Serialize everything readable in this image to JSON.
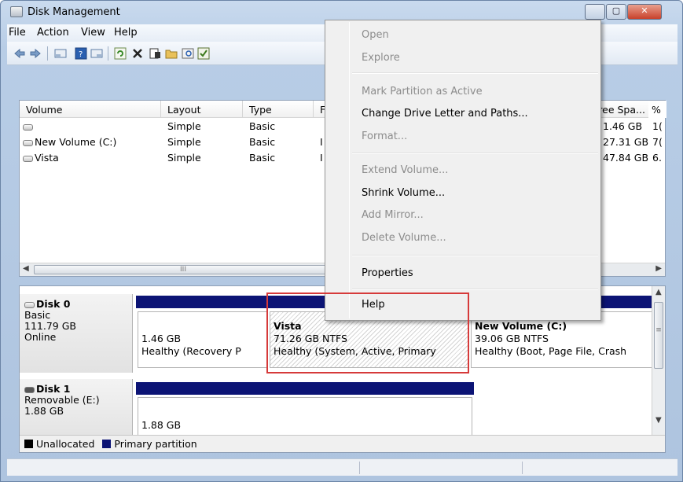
{
  "window": {
    "title": "Disk Management",
    "controls": {
      "minimize": "",
      "maximize": "▢",
      "close": "✕"
    }
  },
  "menubar": [
    "File",
    "Action",
    "View",
    "Help"
  ],
  "toolbar_icons": [
    "back-icon",
    "forward-icon",
    "console-tree-icon",
    "help-icon",
    "properties-list-icon",
    "refresh-icon",
    "delete-icon",
    "properties-icon",
    "open-icon",
    "search-icon",
    "disk-settings-icon"
  ],
  "volume_list": {
    "columns": [
      "Volume",
      "Layout",
      "Type",
      "F",
      "Free Spa...",
      "%"
    ],
    "rows": [
      {
        "volume": "",
        "layout": "Simple",
        "type": "Basic",
        "fs": "",
        "free": "1.46 GB",
        "pct": "1("
      },
      {
        "volume": "New Volume (C:)",
        "layout": "Simple",
        "type": "Basic",
        "fs": "I",
        "free": "27.31 GB",
        "pct": "7("
      },
      {
        "volume": "Vista",
        "layout": "Simple",
        "type": "Basic",
        "fs": "I",
        "free": "47.84 GB",
        "pct": "6."
      }
    ],
    "scroll_thumb_grip": "III"
  },
  "disks": [
    {
      "name": "Disk 0",
      "kind": "Basic",
      "size": "111.79 GB",
      "status": "Online",
      "partitions": [
        {
          "title": "",
          "size": "1.46 GB",
          "status": "Healthy (Recovery P"
        },
        {
          "title": "Vista",
          "size": "71.26 GB NTFS",
          "status": "Healthy (System, Active, Primary"
        },
        {
          "title": "New Volume (C:)",
          "size": "39.06 GB NTFS",
          "status": "Healthy (Boot, Page File, Crash"
        }
      ]
    },
    {
      "name": "Disk 1",
      "kind": "Removable (E:)",
      "size": "1.88 GB",
      "partitions": [
        {
          "title": "",
          "size": "1.88 GB",
          "status": ""
        }
      ]
    }
  ],
  "legend": {
    "unallocated": "Unallocated",
    "primary": "Primary partition"
  },
  "colors": {
    "unallocated": "#000000",
    "primary": "#0c1475",
    "highlight": "#d63a3a"
  },
  "context_menu": [
    {
      "label": "Open",
      "enabled": false
    },
    {
      "label": "Explore",
      "enabled": false
    },
    {
      "label": "Mark Partition as Active",
      "enabled": false
    },
    {
      "label": "Change Drive Letter and Paths...",
      "enabled": true
    },
    {
      "label": "Format...",
      "enabled": false
    },
    {
      "label": "Extend Volume...",
      "enabled": false
    },
    {
      "label": "Shrink Volume...",
      "enabled": true
    },
    {
      "label": "Add Mirror...",
      "enabled": false
    },
    {
      "label": "Delete Volume...",
      "enabled": false
    },
    {
      "label": "Properties",
      "enabled": true
    },
    {
      "label": "Help",
      "enabled": true
    }
  ]
}
